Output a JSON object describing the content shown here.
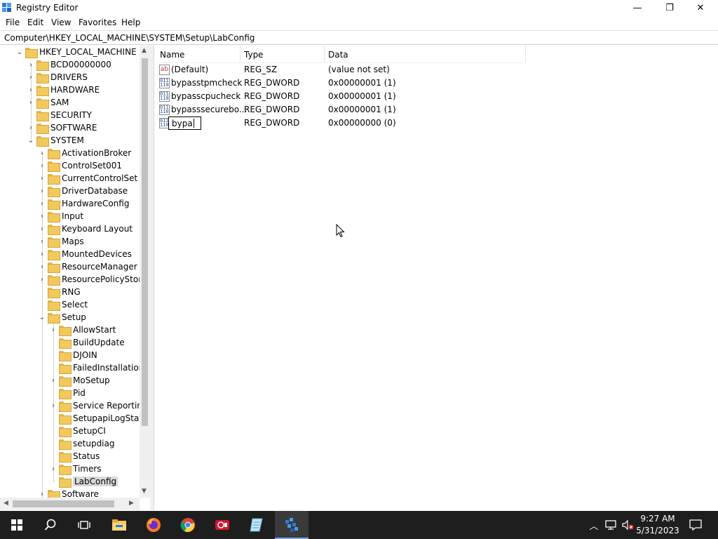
{
  "window": {
    "title": "Registry Editor",
    "minimize": "—",
    "restore": "❐",
    "close": "✕"
  },
  "menu": [
    "File",
    "Edit",
    "View",
    "Favorites",
    "Help"
  ],
  "address": "Computer\\HKEY_LOCAL_MACHINE\\SYSTEM\\Setup\\LabConfig",
  "tree": {
    "root": "HKEY_LOCAL_MACHINE",
    "hklm_children": [
      "BCD00000000",
      "DRIVERS",
      "HARDWARE",
      "SAM",
      "SECURITY",
      "SOFTWARE",
      "SYSTEM"
    ],
    "system_children": [
      "ActivationBroker",
      "ControlSet001",
      "CurrentControlSet",
      "DriverDatabase",
      "HardwareConfig",
      "Input",
      "Keyboard Layout",
      "Maps",
      "MountedDevices",
      "ResourceManager",
      "ResourcePolicyStore",
      "RNG",
      "Select",
      "Setup"
    ],
    "setup_children": [
      "AllowStart",
      "BuildUpdate",
      "DJOIN",
      "FailedInstallations",
      "MoSetup",
      "Pid",
      "Service Reporting",
      "SetupapiLogStatus",
      "SetupCI",
      "setupdiag",
      "Status",
      "Timers",
      "LabConfig"
    ],
    "after_setup": "Software",
    "selected": "LabConfig"
  },
  "columns": {
    "name": "Name",
    "type": "Type",
    "data": "Data"
  },
  "values": [
    {
      "name": "(Default)",
      "type": "REG_SZ",
      "data": "(value not set)",
      "icon": "string-value-icon"
    },
    {
      "name": "bypasstpmcheck",
      "type": "REG_DWORD",
      "data": "0x00000001 (1)",
      "icon": "dword-value-icon"
    },
    {
      "name": "bypasscpucheck",
      "type": "REG_DWORD",
      "data": "0x00000001 (1)",
      "icon": "dword-value-icon"
    },
    {
      "name": "bypasssecurebo...",
      "type": "REG_DWORD",
      "data": "0x00000001 (1)",
      "icon": "dword-value-icon"
    },
    {
      "name": "bypa",
      "type": "REG_DWORD",
      "data": "0x00000000 (0)",
      "icon": "dword-value-icon",
      "editing": true
    }
  ],
  "taskbar": {
    "apps": [
      "start-icon",
      "search-icon",
      "task-view-icon",
      "file-explorer-icon",
      "firefox-icon",
      "chrome-icon",
      "screen-recorder-icon",
      "notepad-icon",
      "regedit-icon"
    ],
    "active": "regedit-icon",
    "time": "9:27 AM",
    "date": "5/31/2023"
  },
  "colors": {
    "taskbar": "#1e1e1e",
    "folder": "#f3c85c",
    "selection": "#d9d9d9",
    "accent": "#7aa7e0"
  }
}
